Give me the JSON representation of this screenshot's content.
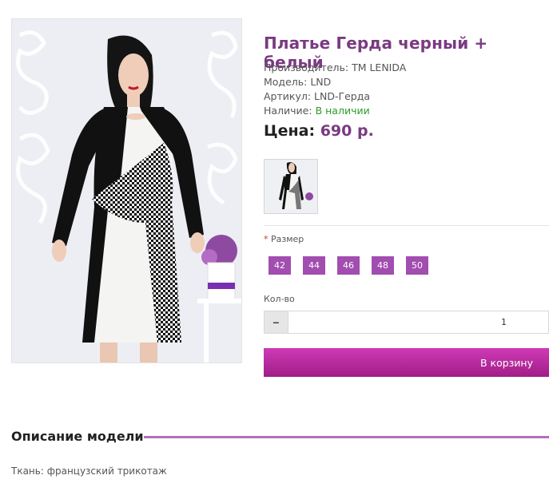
{
  "product": {
    "title": "Платье Герда черный + белый",
    "manufacturer_label": "Производитель:",
    "manufacturer": "ТМ LENIDA",
    "model_label": "Модель:",
    "model": "LND",
    "article_label": "Артикул:",
    "article": "LND-Герда",
    "availability_label": "Наличие:",
    "availability": "В наличии",
    "price_label": "Цена:",
    "price": "690 р."
  },
  "options": {
    "size_required_mark": "*",
    "size_label": "Размер",
    "sizes": [
      "42",
      "44",
      "46",
      "48",
      "50"
    ],
    "qty_label": "Кол-во",
    "qty_value": "1",
    "qty_minus_icon": "minus-icon"
  },
  "actions": {
    "cart_label": "В корзину"
  },
  "description": {
    "title": "Описание модели",
    "text": "Ткань: французский трикотаж"
  },
  "colors": {
    "accent": "#7a3a82",
    "button": "#a24db0",
    "cart": "#b8269c",
    "available": "#2a9d2a"
  }
}
